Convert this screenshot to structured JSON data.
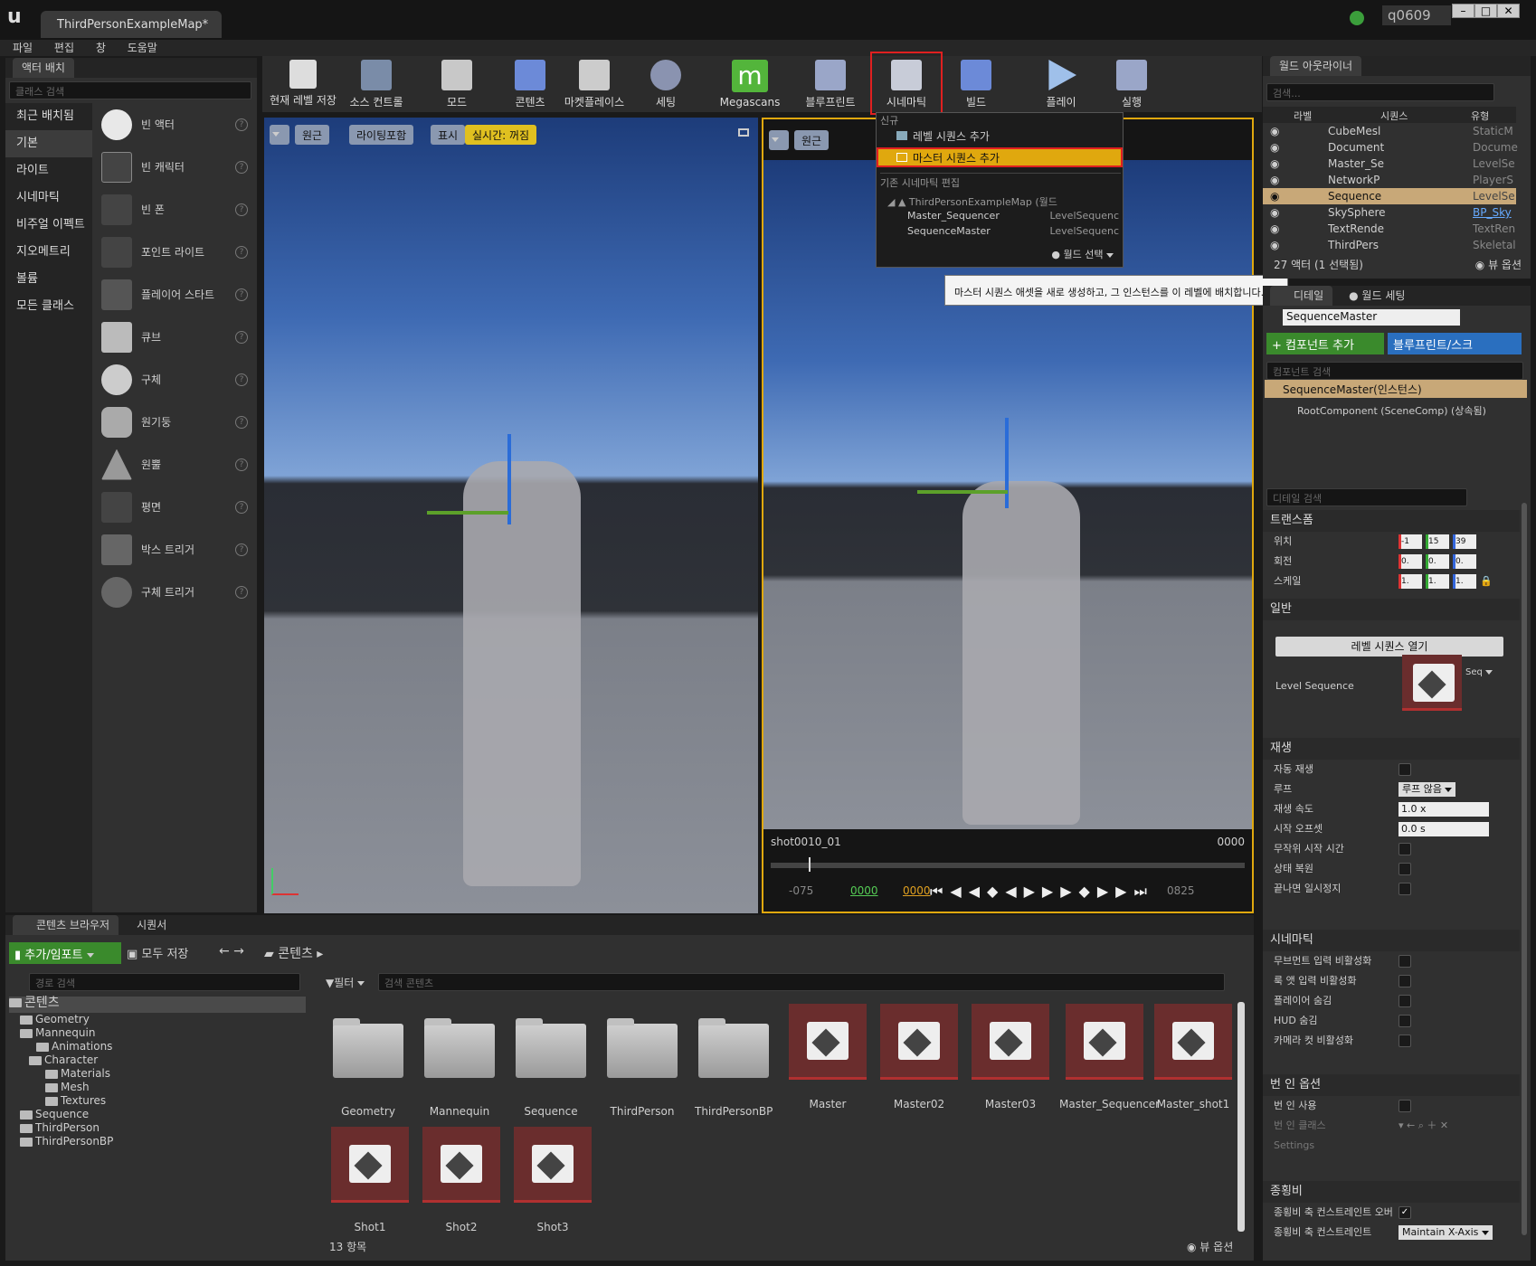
{
  "window": {
    "title": "ThirdPersonExampleMap*",
    "user": "q0609"
  },
  "menu": [
    "파일",
    "편집",
    "창",
    "도움말"
  ],
  "place": {
    "tab": "액터 배치",
    "search_placeholder": "클래스 검색",
    "categories": [
      "최근 배치됨",
      "기본",
      "라이트",
      "시네마틱",
      "비주얼 이펙트",
      "지오메트리",
      "볼륨",
      "모든 클래스"
    ],
    "items": [
      "빈 액터",
      "빈 캐릭터",
      "빈 폰",
      "포인트 라이트",
      "플레이어 스타트",
      "큐브",
      "구체",
      "원기둥",
      "원뿔",
      "평면",
      "박스 트리거",
      "구체 트리거"
    ]
  },
  "toolbar": [
    "현재 레벨 저장",
    "소스 컨트롤",
    "모드",
    "콘텐츠",
    "마켓플레이스",
    "세팅",
    "Megascans",
    "블루프린트",
    "시네마틱",
    "빌드",
    "플레이",
    "실행"
  ],
  "viewport_left": {
    "persp": "원근",
    "lit": "라이팅포함",
    "show": "표시",
    "realtime": "실시간: 꺼짐"
  },
  "viewport_right": {
    "persp": "원근",
    "shot": "shot0010_01",
    "frame": "0000",
    "t_start": "-075",
    "t_green": "0000",
    "t_orange": "0000",
    "t_end": "0825"
  },
  "cine_menu": {
    "section_new": "신규",
    "add_level": "레벨 시퀀스 추가",
    "add_master": "마스터 시퀀스 추가",
    "section_edit": "기존 시네마틱 편집",
    "world": "ThirdPersonExampleMap (월드",
    "items": [
      {
        "name": "Master_Sequencer",
        "type": "LevelSequenc"
      },
      {
        "name": "SequenceMaster",
        "type": "LevelSequenc"
      }
    ],
    "world_select": "월드 선택"
  },
  "tooltip": "마스터 시퀀스 애셋을 새로 생성하고, 그 인스턴스를 이 레벨에 배치합니다.",
  "outliner": {
    "tab": "월드 아웃라이너",
    "search_placeholder": "검색...",
    "col_label": "라벨",
    "col_seq": "시퀀스",
    "col_type": "유형",
    "rows": [
      {
        "label": "CubeMesl",
        "type": "StaticM"
      },
      {
        "label": "Document",
        "type": "Docume"
      },
      {
        "label": "Master_Se",
        "type": "LevelSe"
      },
      {
        "label": "NetworkP",
        "type": "PlayerS"
      },
      {
        "label": "Sequence",
        "type": "LevelSe"
      },
      {
        "label": "SkySphere",
        "type": "BP_Sky"
      },
      {
        "label": "TextRende",
        "type": "TextRen"
      },
      {
        "label": "ThirdPers",
        "type": "Skeletal"
      }
    ],
    "count": "27 액터 (1 선택됨)",
    "view_options": "뷰 옵션"
  },
  "details": {
    "tab": "디테일",
    "tab2": "월드 세팅",
    "name": "SequenceMaster",
    "add_component": "+ 컴포넌트 추가",
    "blueprint": "블루프린트/스크",
    "comp_search": "컴포넌트 검색",
    "instance": "SequenceMaster(인스턴스)",
    "root": "RootComponent (SceneComp) (상속됨)",
    "search": "디테일 검색",
    "transform": "트랜스폼",
    "loc": "위치",
    "rot": "회전",
    "scale": "스케일",
    "loc_v": [
      "-1",
      "15",
      "39"
    ],
    "rot_v": [
      "0.",
      "0.",
      "0."
    ],
    "scale_v": [
      "1.",
      "1.",
      "1."
    ],
    "general": "일반",
    "open_seq": "레벨 시퀀스 열기",
    "level_sequence": "Level Sequence",
    "seq_dd": "Seq",
    "playback": "재생",
    "autoplay": "자동 재생",
    "loop": "루프",
    "loop_v": "루프 않음",
    "rate": "재생 속도",
    "rate_v": "1.0 x",
    "offset": "시작 오프셋",
    "offset_v": "0.0 s",
    "random": "무작위 시작 시간",
    "restore": "상태 복원",
    "pause_end": "끝나면 일시정지",
    "cinematic": "시네마틱",
    "c1": "무브먼트 입력 비활성화",
    "c2": "룩 앳 입력 비활성화",
    "c3": "플레이어 숨김",
    "c4": "HUD 숨김",
    "c5": "카메라 컷 비활성화",
    "burnin": "번 인 옵션",
    "b1": "번 인 사용",
    "b2": "번 인 클래스",
    "b3": "Settings",
    "aspect": "종횡비",
    "a1": "종횡비 축 컨스트레인트 오버",
    "a2": "종횡비 축 컨스트레인트",
    "a2_v": "Maintain X-Axis"
  },
  "content": {
    "tab": "콘텐츠 브라우저",
    "tab2": "시퀀서",
    "add": "추가/임포트",
    "save_all": "모두 저장",
    "path": "콘텐츠",
    "path_search": "경로 검색",
    "filter": "필터",
    "search": "검색 콘텐츠",
    "tree": [
      "콘텐츠",
      "Geometry",
      "Mannequin",
      "Animations",
      "Character",
      "Materials",
      "Mesh",
      "Textures",
      "Sequence",
      "ThirdPerson",
      "ThirdPersonBP"
    ],
    "folders": [
      "Geometry",
      "Mannequin",
      "Sequence",
      "ThirdPerson",
      "ThirdPersonBP"
    ],
    "sequences": [
      "Master",
      "Master02",
      "Master03",
      "Master_Sequencer",
      "Master_shot1",
      "Shot1",
      "Shot2",
      "Shot3"
    ],
    "count": "13 항목",
    "view_options": "뷰 옵션"
  },
  "colors": {
    "accent": "#e0a80e",
    "highlight_red": "#e02020",
    "green_btn": "#3a8a2c",
    "blue_btn": "#2a6fbf"
  }
}
